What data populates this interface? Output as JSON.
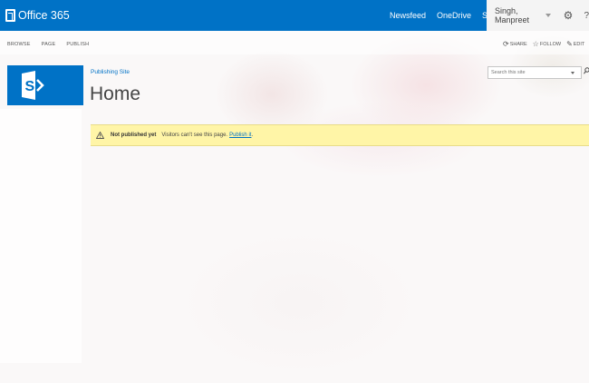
{
  "suite_bar": {
    "brand": "Office 365",
    "nav": [
      {
        "label": "Newsfeed"
      },
      {
        "label": "OneDrive"
      },
      {
        "label": "Sites"
      }
    ],
    "user_name": "Singh, Manpreet",
    "help_glyph": "?"
  },
  "ribbon": {
    "tabs": [
      "BROWSE",
      "PAGE",
      "PUBLISH"
    ],
    "share": "SHARE",
    "follow": "FOLLOW",
    "edit": "EDIT"
  },
  "site": {
    "breadcrumb": "Publishing Site",
    "title": "Home"
  },
  "search": {
    "placeholder": "Search this site"
  },
  "status": {
    "title": "Not published yet",
    "text": "Visitors can't see this page.",
    "link": "Publish it",
    "dot": "."
  },
  "colors": {
    "suite_blue": "#0072c6",
    "status_yellow": "#fff5a7"
  },
  "icons": [
    "office-logo-icon",
    "gear-icon",
    "share-icon",
    "follow-star-icon",
    "edit-pencil-icon",
    "sharepoint-logo-icon",
    "search-icon",
    "warning-icon"
  ]
}
